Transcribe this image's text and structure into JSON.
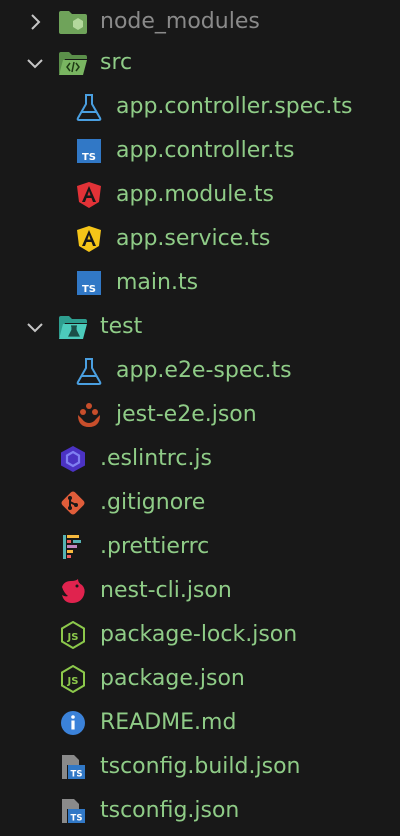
{
  "explorer": {
    "items": [
      {
        "label": "node_modules",
        "kind": "folder",
        "expanded": false,
        "icon": "folder-node-icon",
        "depth": 0,
        "color": "#8a8a8a"
      },
      {
        "label": "src",
        "kind": "folder",
        "expanded": true,
        "icon": "folder-src-icon",
        "depth": 0,
        "color": "#8fcc87"
      },
      {
        "label": "app.controller.spec.ts",
        "kind": "file",
        "icon": "test-flask-icon",
        "depth": 1,
        "color": "#8fcc87"
      },
      {
        "label": "app.controller.ts",
        "kind": "file",
        "icon": "typescript-icon",
        "depth": 1,
        "color": "#8fcc87"
      },
      {
        "label": "app.module.ts",
        "kind": "file",
        "icon": "angular-red-icon",
        "depth": 1,
        "color": "#8fcc87"
      },
      {
        "label": "app.service.ts",
        "kind": "file",
        "icon": "angular-yellow-icon",
        "depth": 1,
        "color": "#8fcc87"
      },
      {
        "label": "main.ts",
        "kind": "file",
        "icon": "typescript-icon",
        "depth": 1,
        "color": "#8fcc87"
      },
      {
        "label": "test",
        "kind": "folder",
        "expanded": true,
        "icon": "folder-test-icon",
        "depth": 0,
        "color": "#8fcc87"
      },
      {
        "label": "app.e2e-spec.ts",
        "kind": "file",
        "icon": "test-flask-icon",
        "depth": 1,
        "color": "#8fcc87"
      },
      {
        "label": "jest-e2e.json",
        "kind": "file",
        "icon": "jest-icon",
        "depth": 1,
        "color": "#8fcc87"
      },
      {
        "label": ".eslintrc.js",
        "kind": "file",
        "icon": "eslint-icon",
        "depth": 0,
        "color": "#8fcc87"
      },
      {
        "label": ".gitignore",
        "kind": "file",
        "icon": "git-icon",
        "depth": 0,
        "color": "#8fcc87"
      },
      {
        "label": ".prettierrc",
        "kind": "file",
        "icon": "prettier-icon",
        "depth": 0,
        "color": "#8fcc87"
      },
      {
        "label": "nest-cli.json",
        "kind": "file",
        "icon": "nestjs-icon",
        "depth": 0,
        "color": "#8fcc87"
      },
      {
        "label": "package-lock.json",
        "kind": "file",
        "icon": "nodejs-icon",
        "depth": 0,
        "color": "#8fcc87"
      },
      {
        "label": "package.json",
        "kind": "file",
        "icon": "nodejs-icon",
        "depth": 0,
        "color": "#8fcc87"
      },
      {
        "label": "README.md",
        "kind": "file",
        "icon": "info-icon",
        "depth": 0,
        "color": "#8fcc87"
      },
      {
        "label": "tsconfig.build.json",
        "kind": "file",
        "icon": "tsconfig-icon",
        "depth": 0,
        "color": "#8fcc87"
      },
      {
        "label": "tsconfig.json",
        "kind": "file",
        "icon": "tsconfig-icon",
        "depth": 0,
        "color": "#8fcc87"
      }
    ]
  }
}
